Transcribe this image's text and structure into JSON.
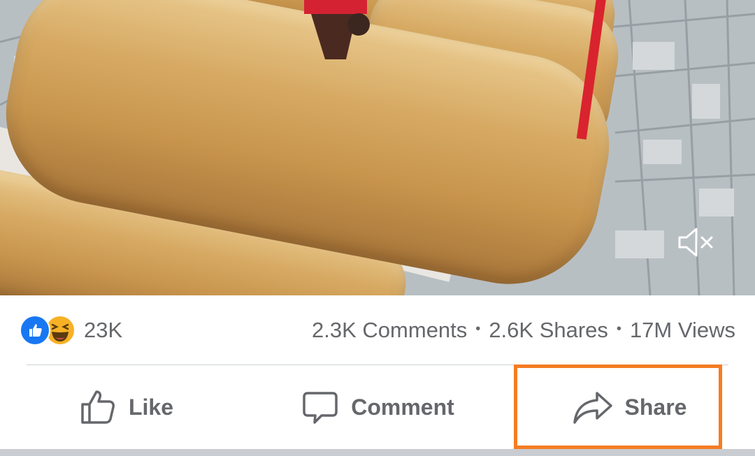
{
  "video": {
    "mute_icon": "speaker-muted-icon"
  },
  "stats": {
    "reaction_icons": [
      "like-icon",
      "haha-icon"
    ],
    "reaction_count": "23K",
    "comments": "2.3K Comments",
    "separator": "•",
    "shares": "2.6K Shares",
    "views": "17M Views"
  },
  "actions": {
    "like_label": "Like",
    "comment_label": "Comment",
    "share_label": "Share"
  },
  "colors": {
    "facebook_blue": "#1877f2",
    "text_gray": "#65676b",
    "highlight_orange": "#f57c22"
  }
}
